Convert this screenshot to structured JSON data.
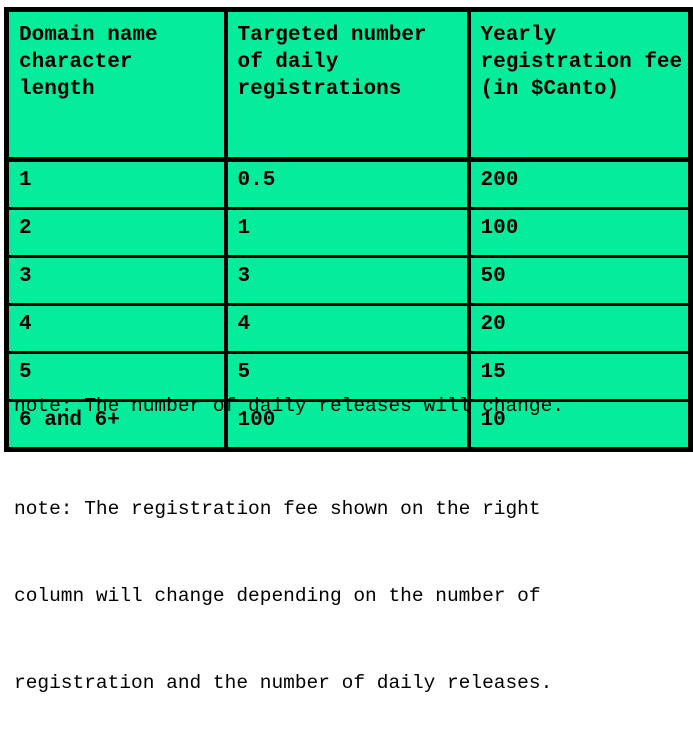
{
  "table": {
    "headers": [
      "Domain name character length",
      "Targeted number of daily registrations",
      "Yearly registration fee (in $Canto)"
    ],
    "rows": [
      {
        "length": "1",
        "daily": "0.5",
        "fee": "200"
      },
      {
        "length": "2",
        "daily": "1",
        "fee": "100"
      },
      {
        "length": "3",
        "daily": "3",
        "fee": "50"
      },
      {
        "length": "4",
        "daily": "4",
        "fee": "20"
      },
      {
        "length": "5",
        "daily": "5",
        "fee": "15"
      },
      {
        "length": "6 and 6+",
        "daily": "100",
        "fee": "10"
      }
    ]
  },
  "notes": {
    "note1": "note: The number of daily releases will change.",
    "note2_line1": "note: The registration fee shown on the right",
    "note2_line2": "column will change depending on the number of",
    "note2_line3": "registration and the number of daily releases."
  },
  "colors": {
    "cell_background": "#04ec9c",
    "border": "#000000",
    "text": "#000000",
    "page_background": "#ffffff"
  }
}
